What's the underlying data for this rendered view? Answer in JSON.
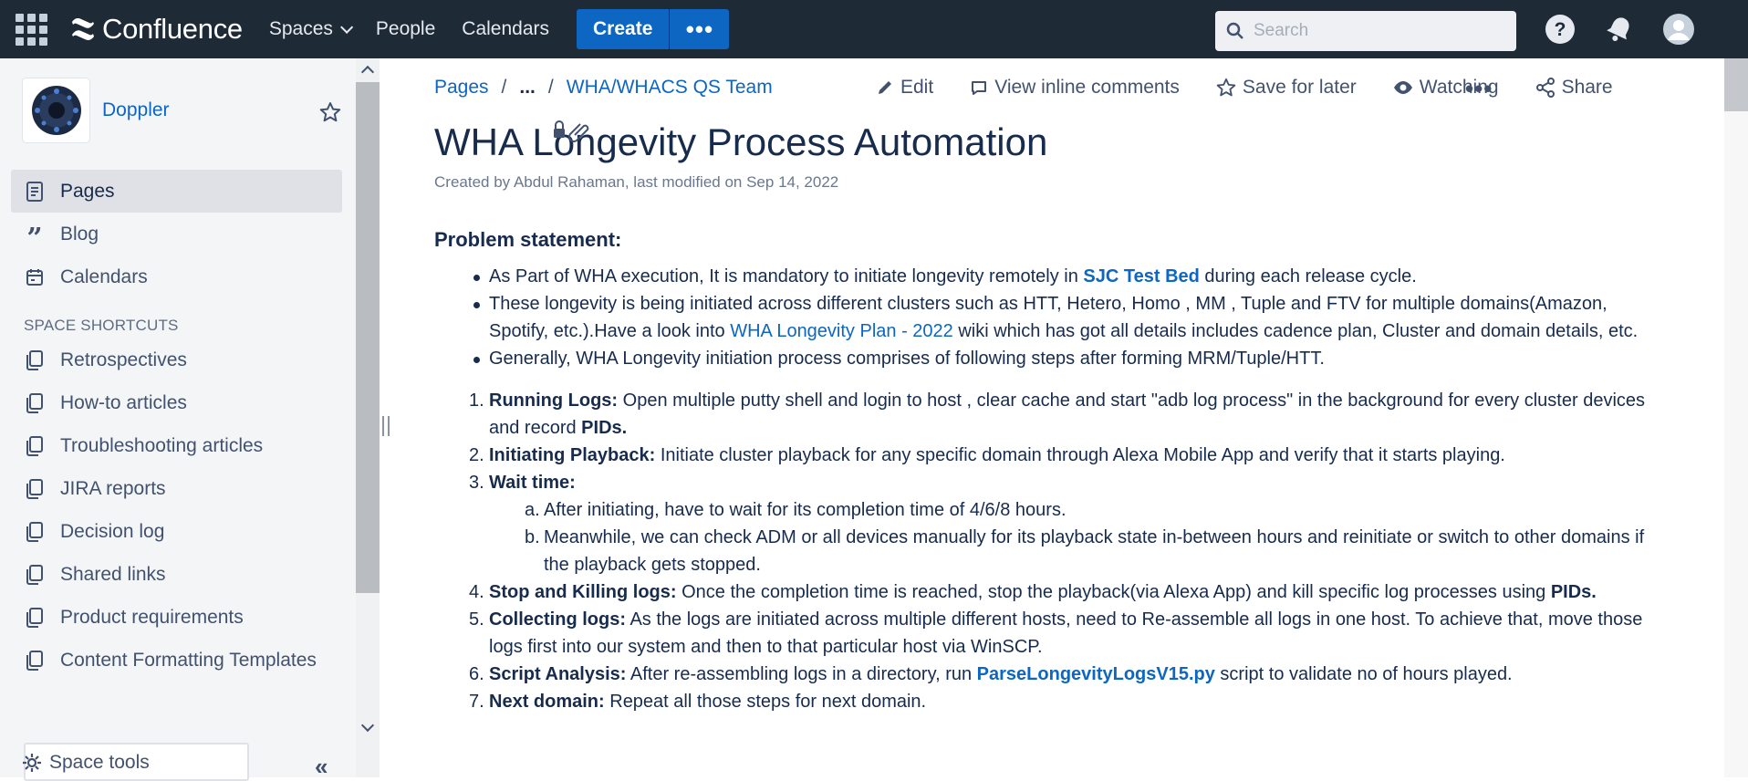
{
  "topnav": {
    "app_name": "Confluence",
    "spaces": "Spaces",
    "people": "People",
    "calendars": "Calendars",
    "create": "Create",
    "search_placeholder": "Search",
    "colors": {
      "bar": "#1f2a37",
      "accent": "#0c66c2"
    }
  },
  "sidebar": {
    "space_name": "Doppler",
    "nav": [
      {
        "label": "Pages",
        "icon": "page-icon",
        "active": true
      },
      {
        "label": "Blog",
        "icon": "quote-icon"
      },
      {
        "label": "Calendars",
        "icon": "calendar-icon"
      }
    ],
    "section_title": "SPACE SHORTCUTS",
    "shortcuts": [
      "Retrospectives",
      "How-to articles",
      "Troubleshooting articles",
      "JIRA reports",
      "Decision log",
      "Shared links",
      "Product requirements",
      "Content Formatting Templates"
    ],
    "space_tools": "Space tools"
  },
  "page": {
    "breadcrumb": {
      "root": "Pages",
      "sep": "/",
      "ellipsis": "...",
      "current": "WHA/WHACS QS Team"
    },
    "actions": {
      "edit": "Edit",
      "comments": "View inline comments",
      "save": "Save for later",
      "watching": "Watching",
      "share": "Share"
    },
    "title": "WHA Longevity Process Automation",
    "meta": "Created by Abdul Rahaman, last modified on Sep 14, 2022",
    "heading": "Problem statement:",
    "bullets": {
      "b1_pre": "As Part of WHA execution, It is mandatory to initiate longevity remotely in ",
      "b1_link": "SJC Test Bed",
      "b1_post": " during each release cycle.",
      "b2_pre": "These longevity is being initiated across different clusters such as HTT, Hetero, Homo , MM , Tuple and FTV for multiple domains(Amazon, Spotify, etc.).Have a look into ",
      "b2_link": "WHA Longevity Plan - 2022",
      "b2_post": " wiki which has got all details includes cadence plan, Cluster and domain details, etc.",
      "b3": "Generally, WHA Longevity initiation process comprises of following steps after forming MRM/Tuple/HTT."
    },
    "steps": {
      "s1_num": "1.",
      "s1_title": "Running Logs:",
      "s1_text": " Open multiple putty shell and login to host , clear cache and start \"adb log process\" in the background for every cluster devices and record ",
      "s1_pids": "PIDs.",
      "s2_num": "2.",
      "s2_title": "Initiating Playback:",
      "s2_text": " Initiate cluster playback for any specific domain through Alexa Mobile App and verify that it starts playing.",
      "s3_num": "3.",
      "s3_title": "Wait time:",
      "s3a_num": "a.",
      "s3a_text": "After initiating, have to wait for its completion time of 4/6/8 hours.",
      "s3b_num": "b.",
      "s3b_text": "Meanwhile, we can check ADM or all devices manually for its playback state in-between hours and reinitiate or switch to other domains if the playback gets stopped.",
      "s4_num": "4.",
      "s4_title": "Stop and Killing logs:",
      "s4_text": " Once the completion time is reached, stop the playback(via Alexa App) and kill specific log processes using ",
      "s4_pids": "PIDs.",
      "s5_num": "5.",
      "s5_title": "Collecting logs:",
      "s5_text": " As the logs are initiated across multiple different hosts, need to Re-assemble all logs in one host. To achieve that, move those logs first into our system and then to that particular host via WinSCP.",
      "s6_num": "6.",
      "s6_title": "Script Analysis:",
      "s6_text_pre": " After re-assembling logs in a directory, run ",
      "s6_link": "ParseLongevityLogsV15.py",
      "s6_text_post": " script to validate no of hours played.",
      "s7_num": "7.",
      "s7_title": "Next domain:",
      "s7_text": " Repeat all those steps for next domain."
    }
  }
}
